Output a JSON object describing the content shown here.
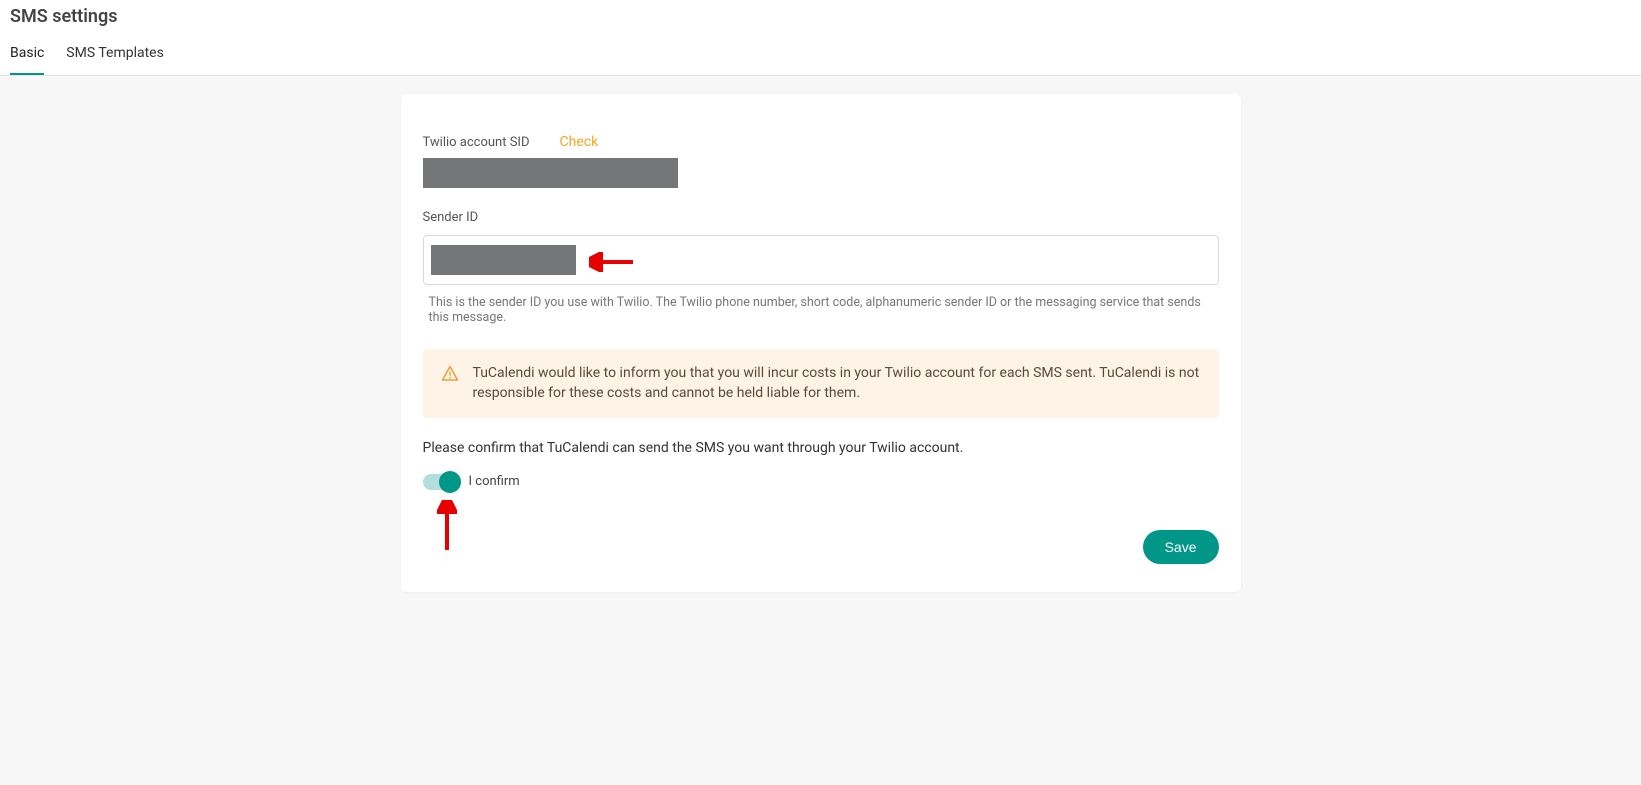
{
  "header": {
    "title": "SMS settings",
    "tabs": [
      {
        "label": "Basic",
        "active": true
      },
      {
        "label": "SMS Templates",
        "active": false
      }
    ]
  },
  "form": {
    "twilio_sid_label": "Twilio account SID",
    "check_label": "Check",
    "sender_id_label": "Sender ID",
    "sender_help": "This is the sender ID you use with Twilio. The Twilio phone number, short code, alphanumeric sender ID or the messaging service that sends this message.",
    "alert_text": "TuCalendi would like to inform you that you will incur costs in your Twilio account for each SMS sent. TuCalendi is not responsible for these costs and cannot be held liable for them.",
    "confirm_prompt": "Please confirm that TuCalendi can send the SMS you want through your Twilio account.",
    "confirm_toggle_label": "I confirm",
    "confirm_toggle_on": true,
    "save_button": "Save"
  },
  "annotations": {
    "arrow_color": "#e60000"
  }
}
